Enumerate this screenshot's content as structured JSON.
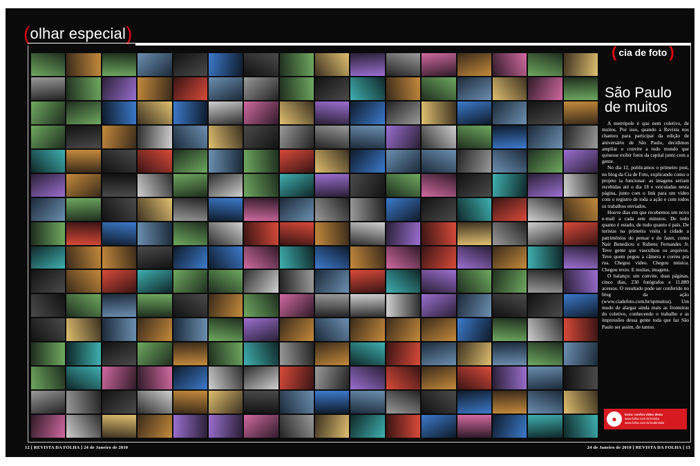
{
  "header": {
    "section": "olhar especial"
  },
  "badge": {
    "label": "cia de foto"
  },
  "article": {
    "title_line1": "São Paulo",
    "title_line2": "de muitos",
    "paragraphs": [
      "A metrópole é que nem coletivo, de muitos. Por isso, quando a Revista nos chamou para participar da edição de aniversário de São Paulo, decidimos ampliar o convite a todo mundo que quisesse exibir fotos da capital junto com a gente.",
      "No dia 12, publicamos o primeiro post, no blog da Cia de Foto, explicando como o projeto ia funcionar: as imagens seriam recebidas até o dia 18 e veiculadas nesta página, junto com o link para um vídeo com o registro de toda a ação e com todos os trabalhos enviados.",
      "Houve dias em que recebemos um novo e-mail a cada sete minutos. De tudo quanto é estado, de tudo quanto é país. De turistas na primeira visita à cidade a patrimônios do pensar e do fazer, como Nair Benedicto e Rubens Fernandes Jr. Teve gente que vasculhou os arquivos. Teve quem pegou a câmera e correu pra rua. Chegou vídeo. Chegou música. Chegou texto. E muitas, imagens.",
      "O balanço: um convite, duas páginas, cinco dias, 230 fotógrafos e 11.889 acessos. O resultado pode ser conferido no blog da ação (www.ciadefoto.com.br/spmuitos). Um modo de alargar ainda mais as fronteiras do coletivo, conhecendo o trabalho e as impressões dessa gente toda que faz São Paulo ser assim, de tantos."
    ]
  },
  "promo": {
    "line1": "Extra: confira vídeo desta",
    "line2": "www.folha.com.br/revista",
    "line3": "www.folha.com.br/multimidia"
  },
  "folio": {
    "left": "12 [ REVISTA DA FOLHA ] 24 de Janeiro de 2010",
    "right": "24 de Janeiro de 2010 [ REVISTA DA FOLHA ] 13"
  },
  "colors": {
    "accent": "#e30613",
    "background": "#0a0a0a",
    "promo": "#d71920"
  }
}
